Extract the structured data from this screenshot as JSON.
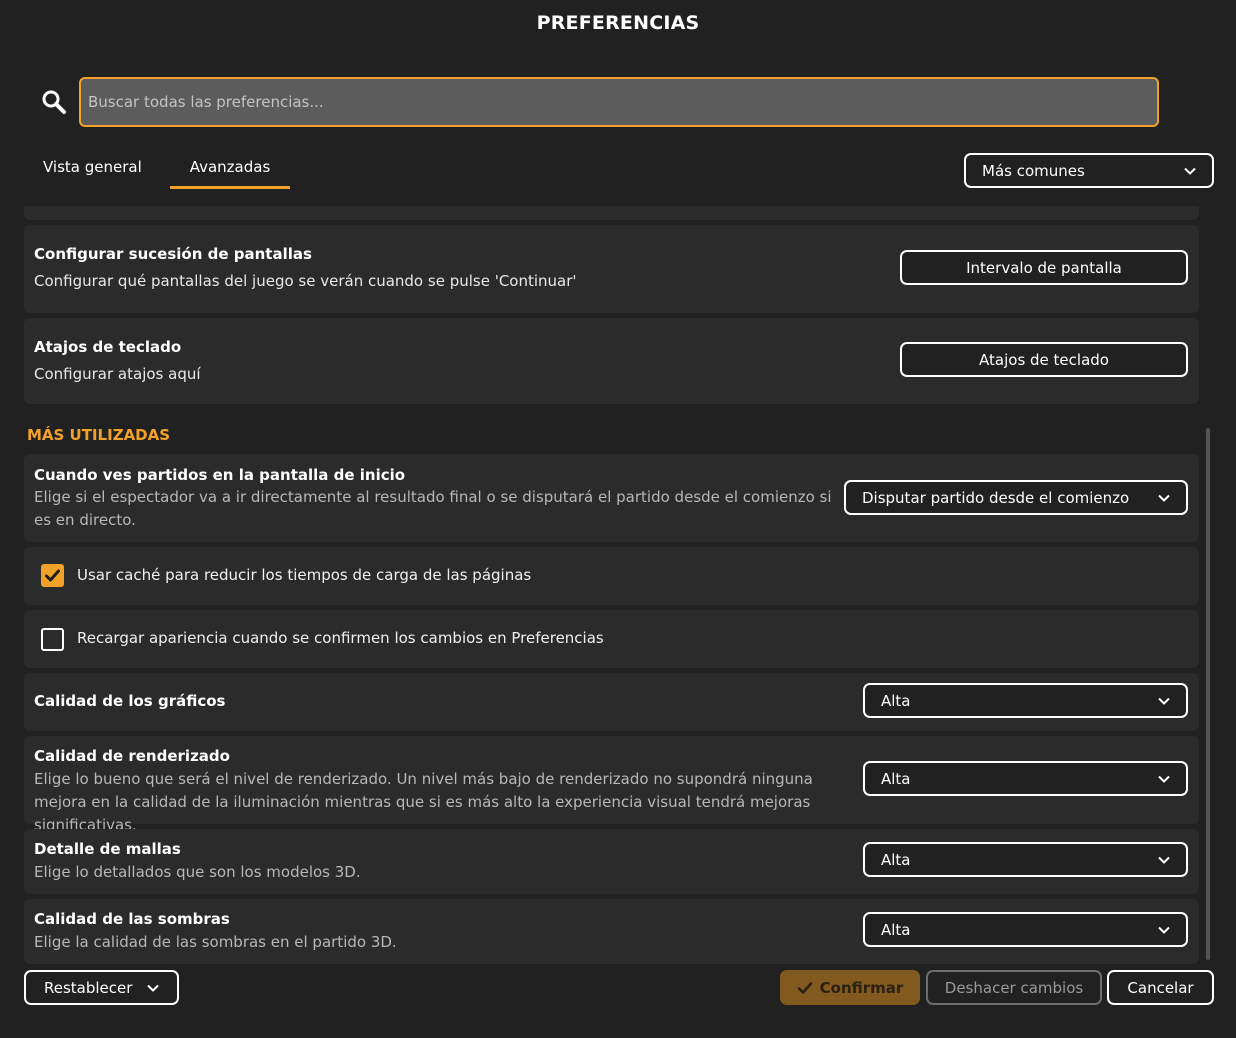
{
  "window": {
    "title": "PREFERENCIAS"
  },
  "search": {
    "placeholder": "Buscar todas las preferencias..."
  },
  "tabs": [
    {
      "label": "Vista general",
      "active": false
    },
    {
      "label": "Avanzadas",
      "active": true
    }
  ],
  "filter": {
    "selected": "Más comunes"
  },
  "advanced_cards": {
    "screen_sequence": {
      "title": "Configurar sucesión de pantallas",
      "description": "Configurar qué pantallas del juego se verán cuando se pulse 'Continuar'",
      "button": "Intervalo de pantalla"
    },
    "shortcuts": {
      "title": "Atajos de teclado",
      "description": "Configurar atajos aquí",
      "button": "Atajos de teclado"
    }
  },
  "most_used": {
    "header": "MÁS UTILIZADAS",
    "match_view": {
      "title": "Cuando ves partidos en la pantalla de inicio",
      "description": "Elige si el espectador va a ir directamente al resultado final o se disputará el partido desde el comienzo si es en directo.",
      "selected": "Disputar partido desde el comienzo"
    },
    "use_cache": {
      "label": "Usar caché para reducir los tiempos de carga de las páginas",
      "checked": true
    },
    "reload_skin": {
      "label": "Recargar apariencia cuando se confirmen los cambios en Preferencias",
      "checked": false
    },
    "graphics_quality": {
      "title": "Calidad de los gráficos",
      "selected": "Alta"
    },
    "render_quality": {
      "title": "Calidad de renderizado",
      "description": "Elige lo bueno que será el nivel de renderizado. Un nivel más bajo de renderizado no supondrá ninguna mejora en la calidad de la iluminación mientras que si es más alto la experiencia visual tendrá mejoras significativas.",
      "selected": "Alta"
    },
    "mesh_detail": {
      "title": "Detalle de mallas",
      "description": "Elige lo detallados que son los modelos 3D.",
      "selected": "Alta"
    },
    "shadow_quality": {
      "title": "Calidad de las sombras",
      "description": "Elige la calidad de las sombras en el partido 3D.",
      "selected": "Alta"
    }
  },
  "footer": {
    "reset": "Restablecer",
    "confirm": "Confirmar",
    "undo": "Deshacer cambios",
    "cancel": "Cancelar"
  },
  "colors": {
    "accent": "#f2a229",
    "background": "#212121",
    "card": "#2b2b2b"
  },
  "icons": [
    "search-icon",
    "chevron-down-icon",
    "checkmark-icon"
  ]
}
